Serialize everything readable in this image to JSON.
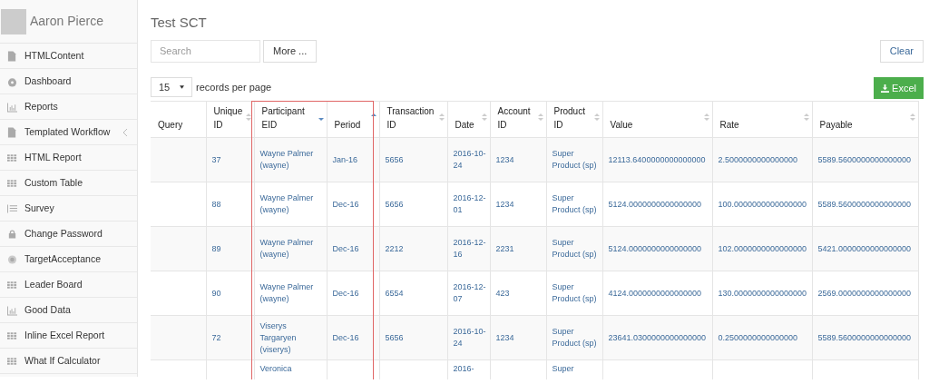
{
  "user": {
    "name": "Aaron Pierce"
  },
  "sidebar": {
    "items": [
      {
        "label": "HTMLContent",
        "kind": "file",
        "expandable": false
      },
      {
        "label": "Dashboard",
        "kind": "gauge",
        "expandable": false
      },
      {
        "label": "Reports",
        "kind": "bars",
        "expandable": false
      },
      {
        "label": "Templated Workflow",
        "kind": "file",
        "expandable": true
      },
      {
        "label": "HTML Report",
        "kind": "grid",
        "expandable": false
      },
      {
        "label": "Custom Table",
        "kind": "grid",
        "expandable": false
      },
      {
        "label": "Survey",
        "kind": "list",
        "expandable": false
      },
      {
        "label": "Change Password",
        "kind": "lock",
        "expandable": false
      },
      {
        "label": "TargetAcceptance",
        "kind": "target",
        "expandable": false
      },
      {
        "label": "Leader Board",
        "kind": "grid",
        "expandable": false
      },
      {
        "label": "Good Data",
        "kind": "bars",
        "expandable": false
      },
      {
        "label": "Inline Excel Report",
        "kind": "grid",
        "expandable": false
      },
      {
        "label": "What If Calculator",
        "kind": "grid",
        "expandable": false
      }
    ]
  },
  "page": {
    "title": "Test SCT"
  },
  "search": {
    "placeholder": "Search"
  },
  "buttons": {
    "more": "More ...",
    "clear": "Clear",
    "excel": "Excel"
  },
  "page_size": {
    "value": "15",
    "label": "records per page"
  },
  "table": {
    "columns": [
      {
        "label": "Query",
        "kind": "plain",
        "highlighted": false
      },
      {
        "label": "Unique ID",
        "kind": "sortable",
        "highlighted": false
      },
      {
        "label": "Participant EID",
        "kind": "descending",
        "highlighted": true
      },
      {
        "label": "Period",
        "kind": "ascending",
        "highlighted": true
      },
      {
        "label": "Transaction ID",
        "kind": "sortable",
        "highlighted": false
      },
      {
        "label": "Date",
        "kind": "sortable",
        "highlighted": false
      },
      {
        "label": "Account ID",
        "kind": "sortable",
        "highlighted": false
      },
      {
        "label": "Product ID",
        "kind": "sortable",
        "highlighted": false
      },
      {
        "label": "Value",
        "kind": "sortable",
        "highlighted": false
      },
      {
        "label": "Rate",
        "kind": "sortable",
        "highlighted": false
      },
      {
        "label": "Payable",
        "kind": "sortable",
        "highlighted": false
      }
    ],
    "rows": [
      [
        "",
        "37",
        "Wayne Palmer (wayne)",
        "Jan-16",
        "5656",
        "2016-10-24",
        "1234",
        "Super Product (sp)",
        "12113.6400000000000000",
        "2.5000000000000000",
        "5589.5600000000000000"
      ],
      [
        "",
        "88",
        "Wayne Palmer (wayne)",
        "Dec-16",
        "5656",
        "2016-12-01",
        "1234",
        "Super Product (sp)",
        "5124.0000000000000000",
        "100.0000000000000000",
        "5589.5600000000000000"
      ],
      [
        "",
        "89",
        "Wayne Palmer (wayne)",
        "Dec-16",
        "2212",
        "2016-12-16",
        "2231",
        "Super Product (sp)",
        "5124.0000000000000000",
        "102.0000000000000000",
        "5421.0000000000000000"
      ],
      [
        "",
        "90",
        "Wayne Palmer (wayne)",
        "Dec-16",
        "6554",
        "2016-12-07",
        "423",
        "Super Product (sp)",
        "4124.0000000000000000",
        "130.0000000000000000",
        "2569.0000000000000000"
      ],
      [
        "",
        "72",
        "Viserys Targaryen (viserys)",
        "Dec-16",
        "5656",
        "2016-10-24",
        "1234",
        "Super Product (sp)",
        "23641.0300000000000000",
        "0.2500000000000000",
        "5589.5600000000000000"
      ],
      [
        "",
        "",
        "Veronica",
        "",
        "",
        "2016-",
        "",
        "Super",
        "",
        "",
        ""
      ]
    ]
  }
}
